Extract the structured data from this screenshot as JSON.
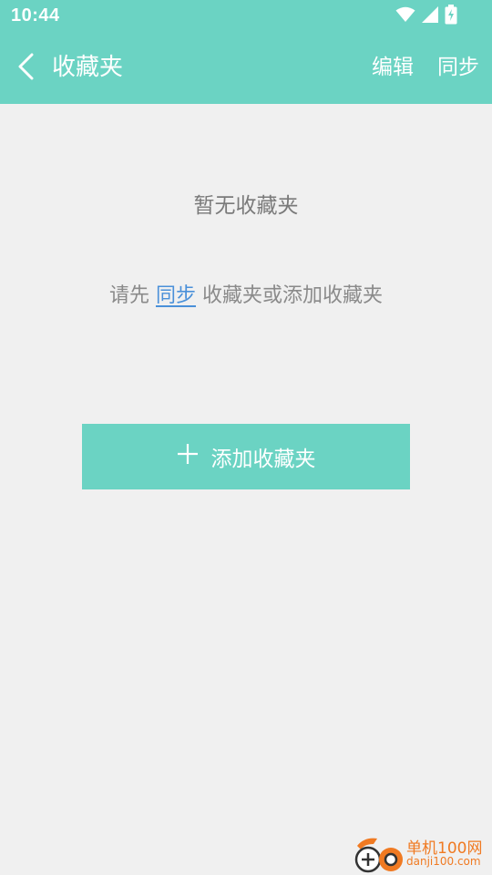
{
  "status_bar": {
    "time": "10:44",
    "icons": [
      "wifi-icon",
      "signal-icon",
      "battery-charging-icon"
    ]
  },
  "app_bar": {
    "title": "收藏夹",
    "edit_label": "编辑",
    "sync_label": "同步",
    "background": "#6bd3c3"
  },
  "empty_state": {
    "title": "暂无收藏夹",
    "hint_prefix": "请先 ",
    "hint_link": "同步",
    "hint_suffix": " 收藏夹或添加收藏夹"
  },
  "add_button": {
    "label": "添加收藏夹",
    "background": "#6bd3c3"
  },
  "watermark": {
    "name": "单机100网",
    "url": "danji100.com"
  }
}
